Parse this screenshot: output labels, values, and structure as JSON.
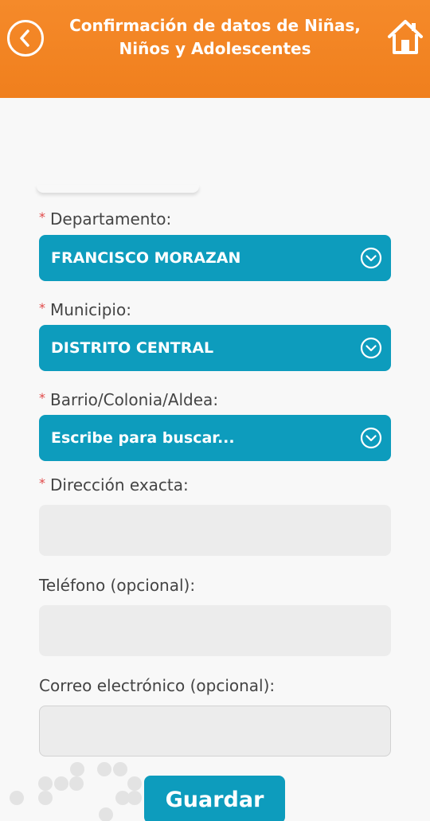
{
  "header": {
    "title_line1": "Confirmación de datos de Niñas,",
    "title_line2": "Niños y Adolescentes",
    "back_icon": "chevron-left-circle-icon",
    "home_icon": "home-icon",
    "background_color": "#f58a2a"
  },
  "form": {
    "departamento": {
      "label": "Departamento:",
      "required_mark": "*",
      "value": "FRANCISCO MORAZAN"
    },
    "municipio": {
      "label": "Municipio:",
      "required_mark": "*",
      "value": "DISTRITO CENTRAL"
    },
    "barrio": {
      "label": "Barrio/Colonia/Aldea:",
      "required_mark": "*",
      "placeholder": "Escribe para buscar..."
    },
    "direccion": {
      "label": "Dirección exacta:",
      "required_mark": "*",
      "value": ""
    },
    "telefono": {
      "label": "Teléfono (opcional):",
      "value": ""
    },
    "correo": {
      "label": "Correo electrónico (opcional):",
      "value": ""
    },
    "select_color": "#0d9cbd"
  },
  "actions": {
    "save_label": "Guardar"
  }
}
